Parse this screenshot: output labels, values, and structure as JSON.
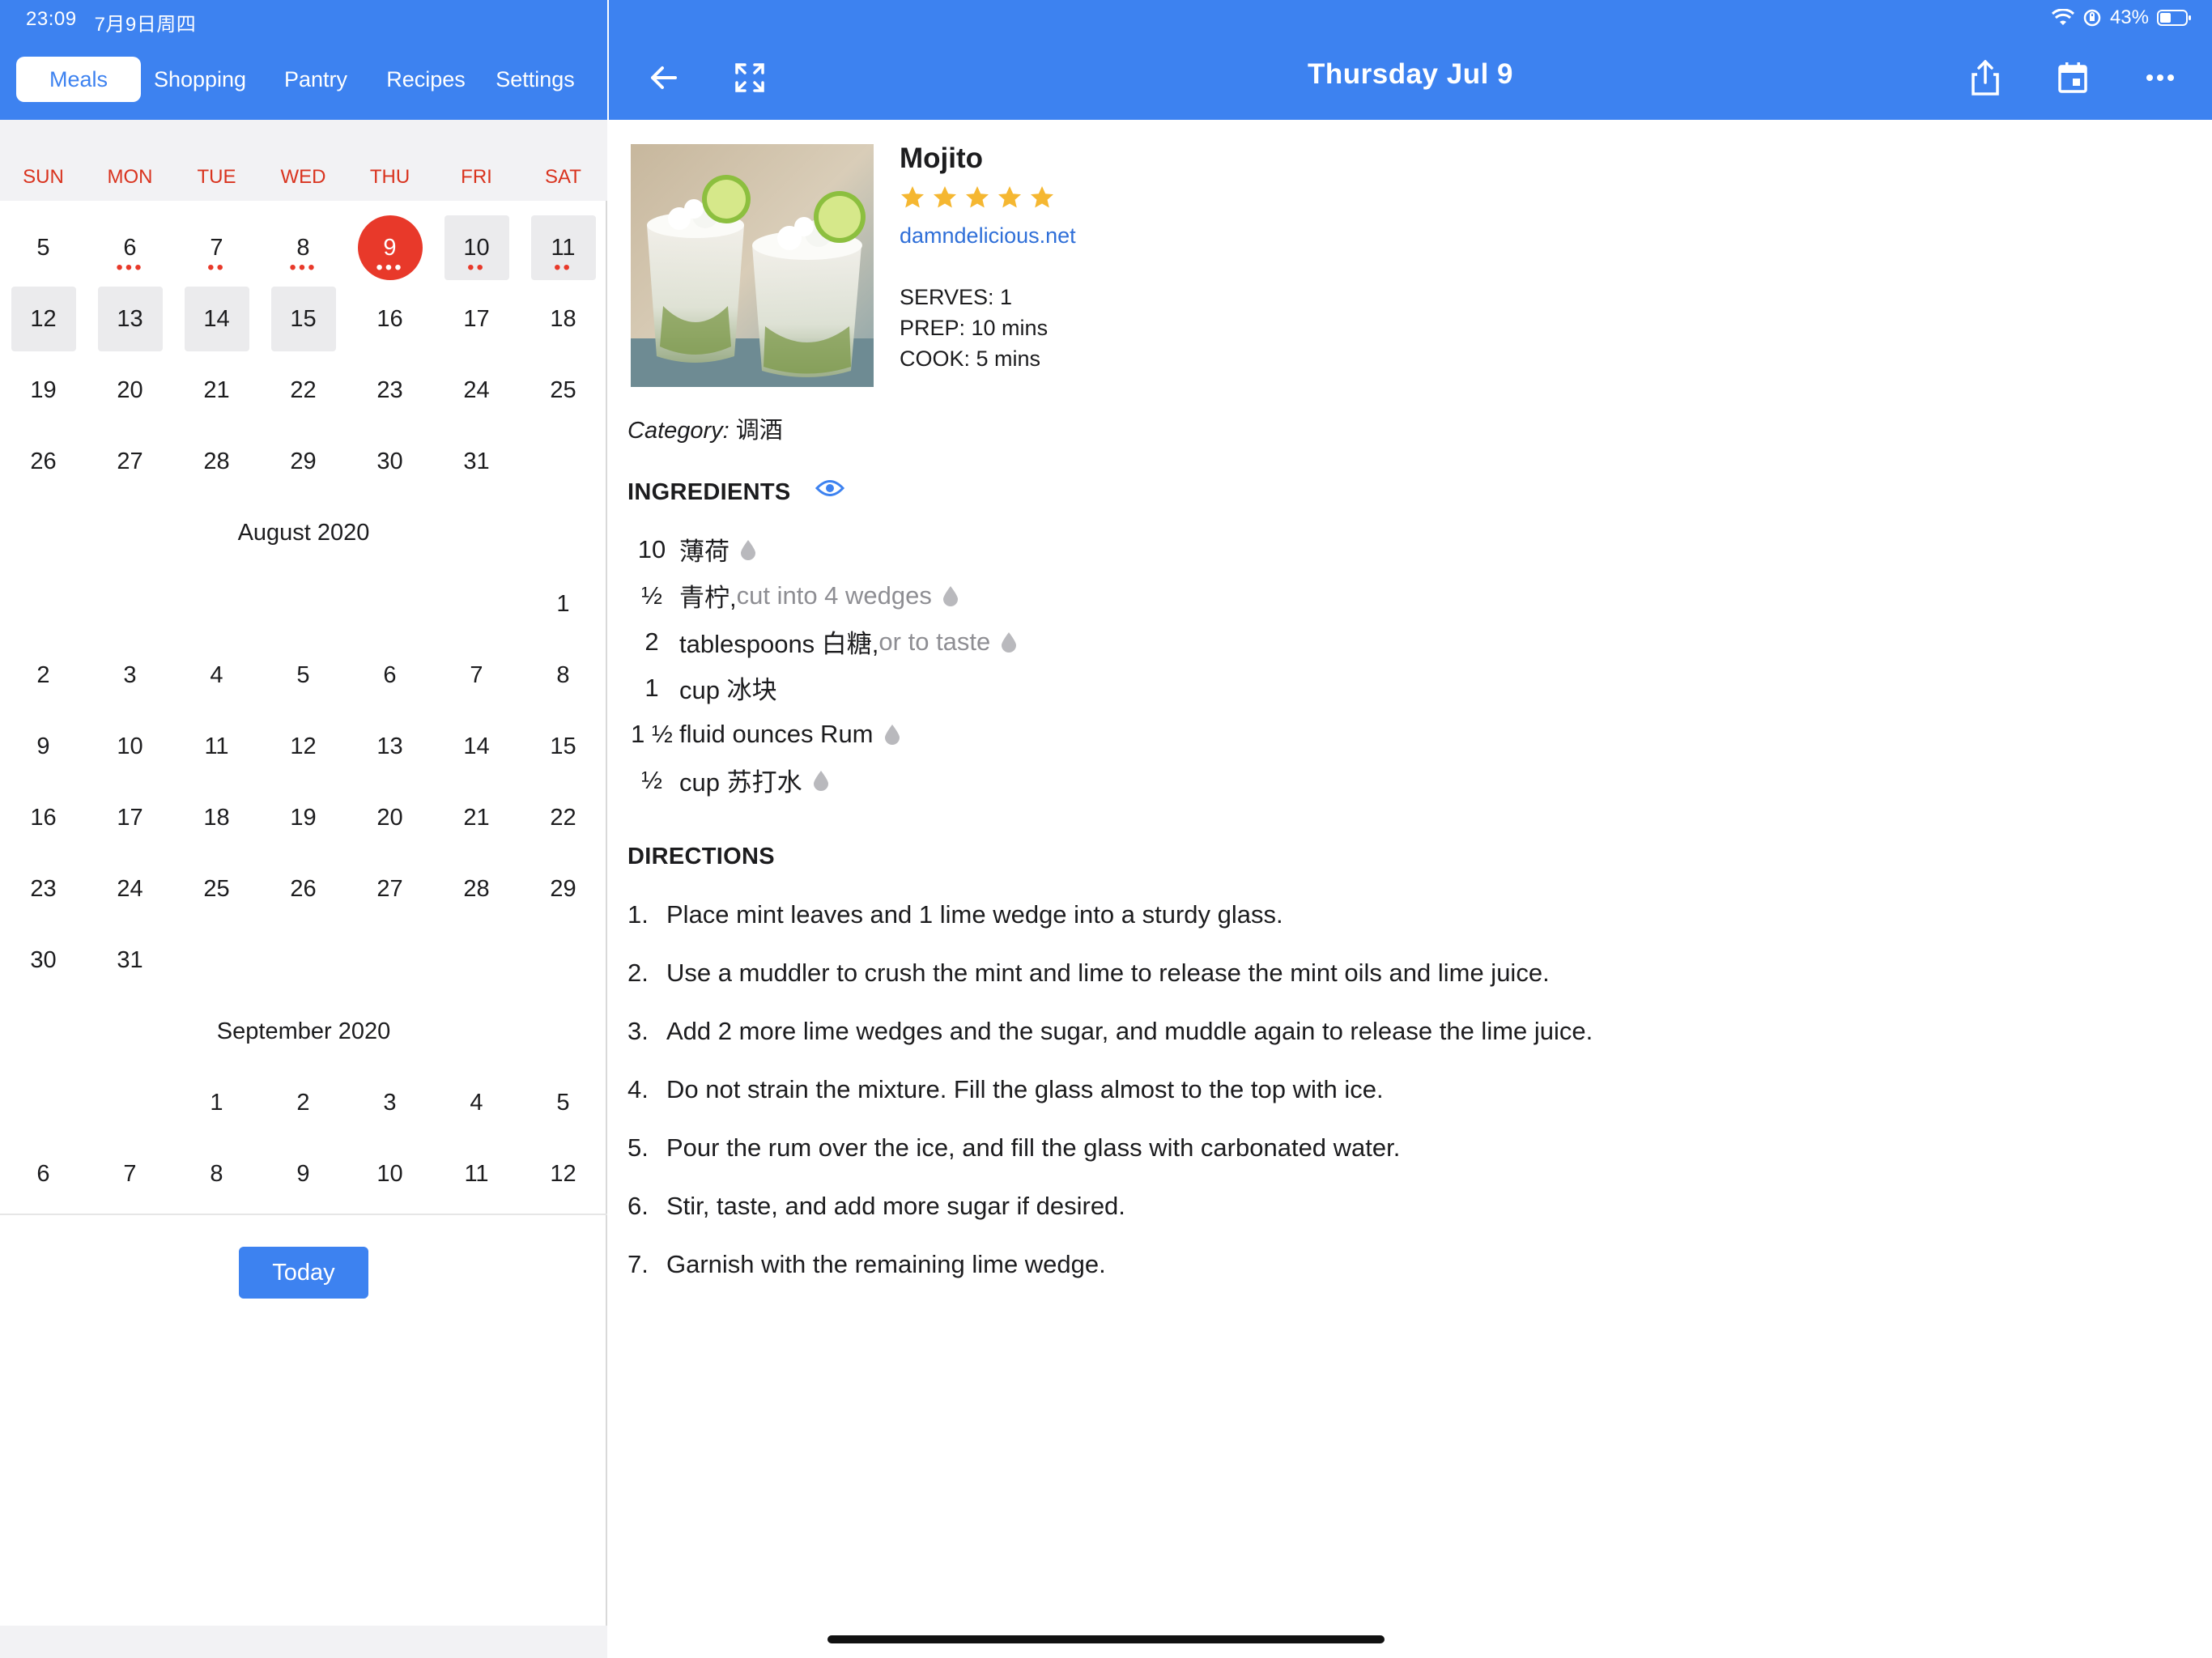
{
  "status": {
    "time": "23:09",
    "date": "7月9日周四",
    "battery": "43%"
  },
  "tabs": [
    {
      "label": "Meals",
      "active": true
    },
    {
      "label": "Shopping",
      "active": false
    },
    {
      "label": "Pantry",
      "active": false
    },
    {
      "label": "Recipes",
      "active": false
    },
    {
      "label": "Settings",
      "active": false
    }
  ],
  "weekdays": [
    "SUN",
    "MON",
    "TUE",
    "WED",
    "THU",
    "FRI",
    "SAT"
  ],
  "calendar": {
    "july_rows": [
      [
        "5",
        "6",
        "7",
        "8",
        "9",
        "10",
        "11"
      ],
      [
        "12",
        "13",
        "14",
        "15",
        "16",
        "17",
        "18"
      ],
      [
        "19",
        "20",
        "21",
        "22",
        "23",
        "24",
        "25"
      ],
      [
        "26",
        "27",
        "28",
        "29",
        "30",
        "31",
        ""
      ]
    ],
    "august_title": "August 2020",
    "august_rows": [
      [
        "",
        "",
        "",
        "",
        "",
        "",
        "1"
      ],
      [
        "2",
        "3",
        "4",
        "5",
        "6",
        "7",
        "8"
      ],
      [
        "9",
        "10",
        "11",
        "12",
        "13",
        "14",
        "15"
      ],
      [
        "16",
        "17",
        "18",
        "19",
        "20",
        "21",
        "22"
      ],
      [
        "23",
        "24",
        "25",
        "26",
        "27",
        "28",
        "29"
      ],
      [
        "30",
        "31",
        "",
        "",
        "",
        "",
        ""
      ]
    ],
    "september_title": "September 2020",
    "september_rows": [
      [
        "",
        "",
        "1",
        "2",
        "3",
        "4",
        "5"
      ],
      [
        "6",
        "7",
        "8",
        "9",
        "10",
        "11",
        "12"
      ]
    ],
    "today_label": "Today"
  },
  "header": {
    "title": "Thursday  Jul 9"
  },
  "recipe": {
    "title": "Mojito",
    "rating": 5,
    "source": "damndelicious.net",
    "serves": "SERVES:  1",
    "prep": "PREP:  10 mins",
    "cook": "COOK:  5 mins",
    "category_label": "Category:",
    "category_value": " 调酒",
    "ingredients_title": "INGREDIENTS",
    "ingredients": [
      {
        "qty": "10",
        "text": "薄荷",
        "note": ""
      },
      {
        "qty": "½",
        "text": "青柠,",
        "note": " cut into 4 wedges"
      },
      {
        "qty": "2",
        "text": "tablespoons 白糖,",
        "note": " or to taste"
      },
      {
        "qty": "1",
        "text": "cup 冰块",
        "note": ""
      },
      {
        "qty": "1 ½",
        "text": "fluid ounces Rum",
        "note": ""
      },
      {
        "qty": "½",
        "text": "cup 苏打水",
        "note": ""
      }
    ],
    "directions_title": "DIRECTIONS",
    "directions": [
      {
        "n": "1.",
        "text": "Place mint leaves and 1 lime wedge into a sturdy glass."
      },
      {
        "n": "2.",
        "text": "Use a muddler to crush the mint and lime to release the mint oils and lime juice."
      },
      {
        "n": "3.",
        "text": "Add 2 more lime wedges and the sugar, and muddle again to release the lime juice."
      },
      {
        "n": "4.",
        "text": "Do not strain the mixture. Fill the glass almost to the top with ice."
      },
      {
        "n": "5.",
        "text": "Pour the rum over the ice, and fill the glass with carbonated water."
      },
      {
        "n": "6.",
        "text": "Stir, taste, and add more sugar if desired."
      },
      {
        "n": "7.",
        "text": "Garnish with the remaining lime wedge."
      }
    ]
  },
  "colors": {
    "accent": "#3d82f0",
    "today": "#e8392a",
    "star": "#f5b731",
    "link": "#2f6fd8"
  }
}
